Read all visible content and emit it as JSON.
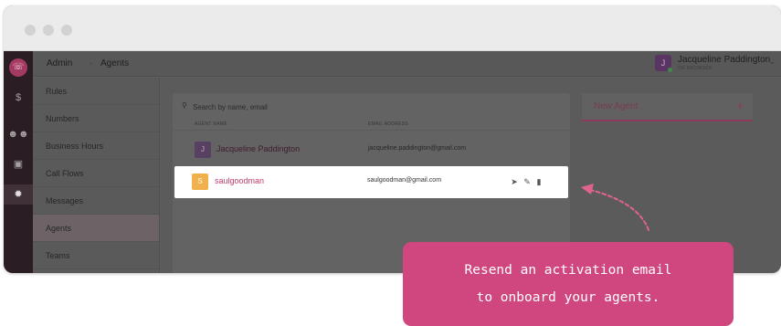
{
  "breadcrumb": {
    "root": "Admin",
    "current": "Agents"
  },
  "profile": {
    "name": "Jacqueline Paddington",
    "status_text": "ON BROWSER"
  },
  "nav": {
    "items": [
      {
        "label": "Rules"
      },
      {
        "label": "Numbers"
      },
      {
        "label": "Business Hours"
      },
      {
        "label": "Call Flows"
      },
      {
        "label": "Messages"
      },
      {
        "label": "Agents",
        "active": true
      },
      {
        "label": "Teams"
      }
    ]
  },
  "rail_icons": [
    "phone-icon",
    "dollar-icon",
    "people-icon",
    "id-card-icon",
    "gear-icon"
  ],
  "search": {
    "placeholder": "Search by name, email"
  },
  "table": {
    "headers": {
      "name": "AGENT NAME",
      "email": "EMAIL ADDRESS"
    },
    "rows": [
      {
        "initial": "J",
        "name": "Jacqueline Paddington",
        "email": "jacqueline.paddington@gmail.com"
      },
      {
        "initial": "S",
        "name": "saulgoodman",
        "email": "saulgoodman@gmail.com",
        "highlighted": true,
        "actions": [
          "send-icon",
          "pencil-icon",
          "trash-icon"
        ]
      }
    ]
  },
  "new_agent": {
    "label": "New Agent",
    "plus": "+"
  },
  "callout": {
    "line1": "Resend an activation email",
    "line2": "to onboard your agents."
  },
  "colors": {
    "accent": "#d0467e",
    "highlight_name": "#c23b6e",
    "avatar_saul": "#f0b04c",
    "avatar_jacqueline": "#584060",
    "arrow": "#e0638f"
  }
}
